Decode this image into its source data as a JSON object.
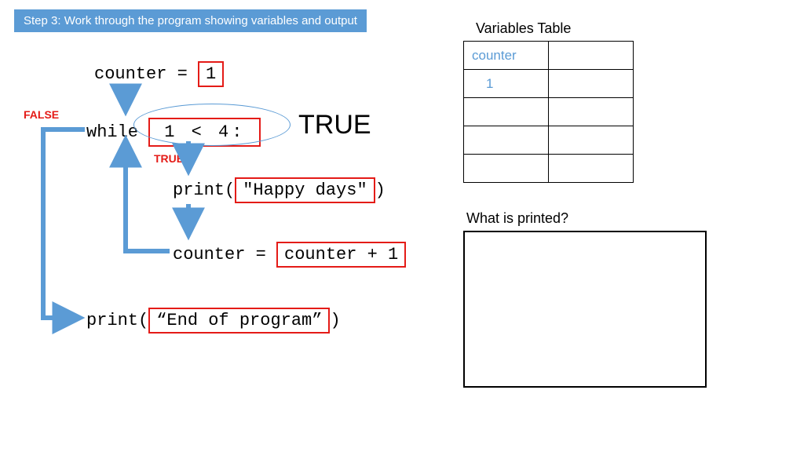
{
  "banner": "Step 3: Work through the program showing variables and output",
  "code": {
    "line1_a": "counter = ",
    "line1_b": "1",
    "line2_a": "while ",
    "line2_b": "1",
    "line2_c": " < 4:",
    "line3_a": "print(",
    "line3_b": "\"Happy days\"",
    "line3_c": ")",
    "line4_a": "counter = ",
    "line4_b": "counter + 1",
    "line5_a": "print(",
    "line5_b": "“End of program”",
    "line5_c": ")"
  },
  "labels": {
    "true_big": "TRUE",
    "false_small": "FALSE",
    "true_small": "TRUE"
  },
  "right": {
    "vt_title": "Variables Table",
    "vt_header": "counter",
    "vt_rows": [
      "1",
      "",
      "",
      ""
    ],
    "wp_title": "What is printed?"
  }
}
